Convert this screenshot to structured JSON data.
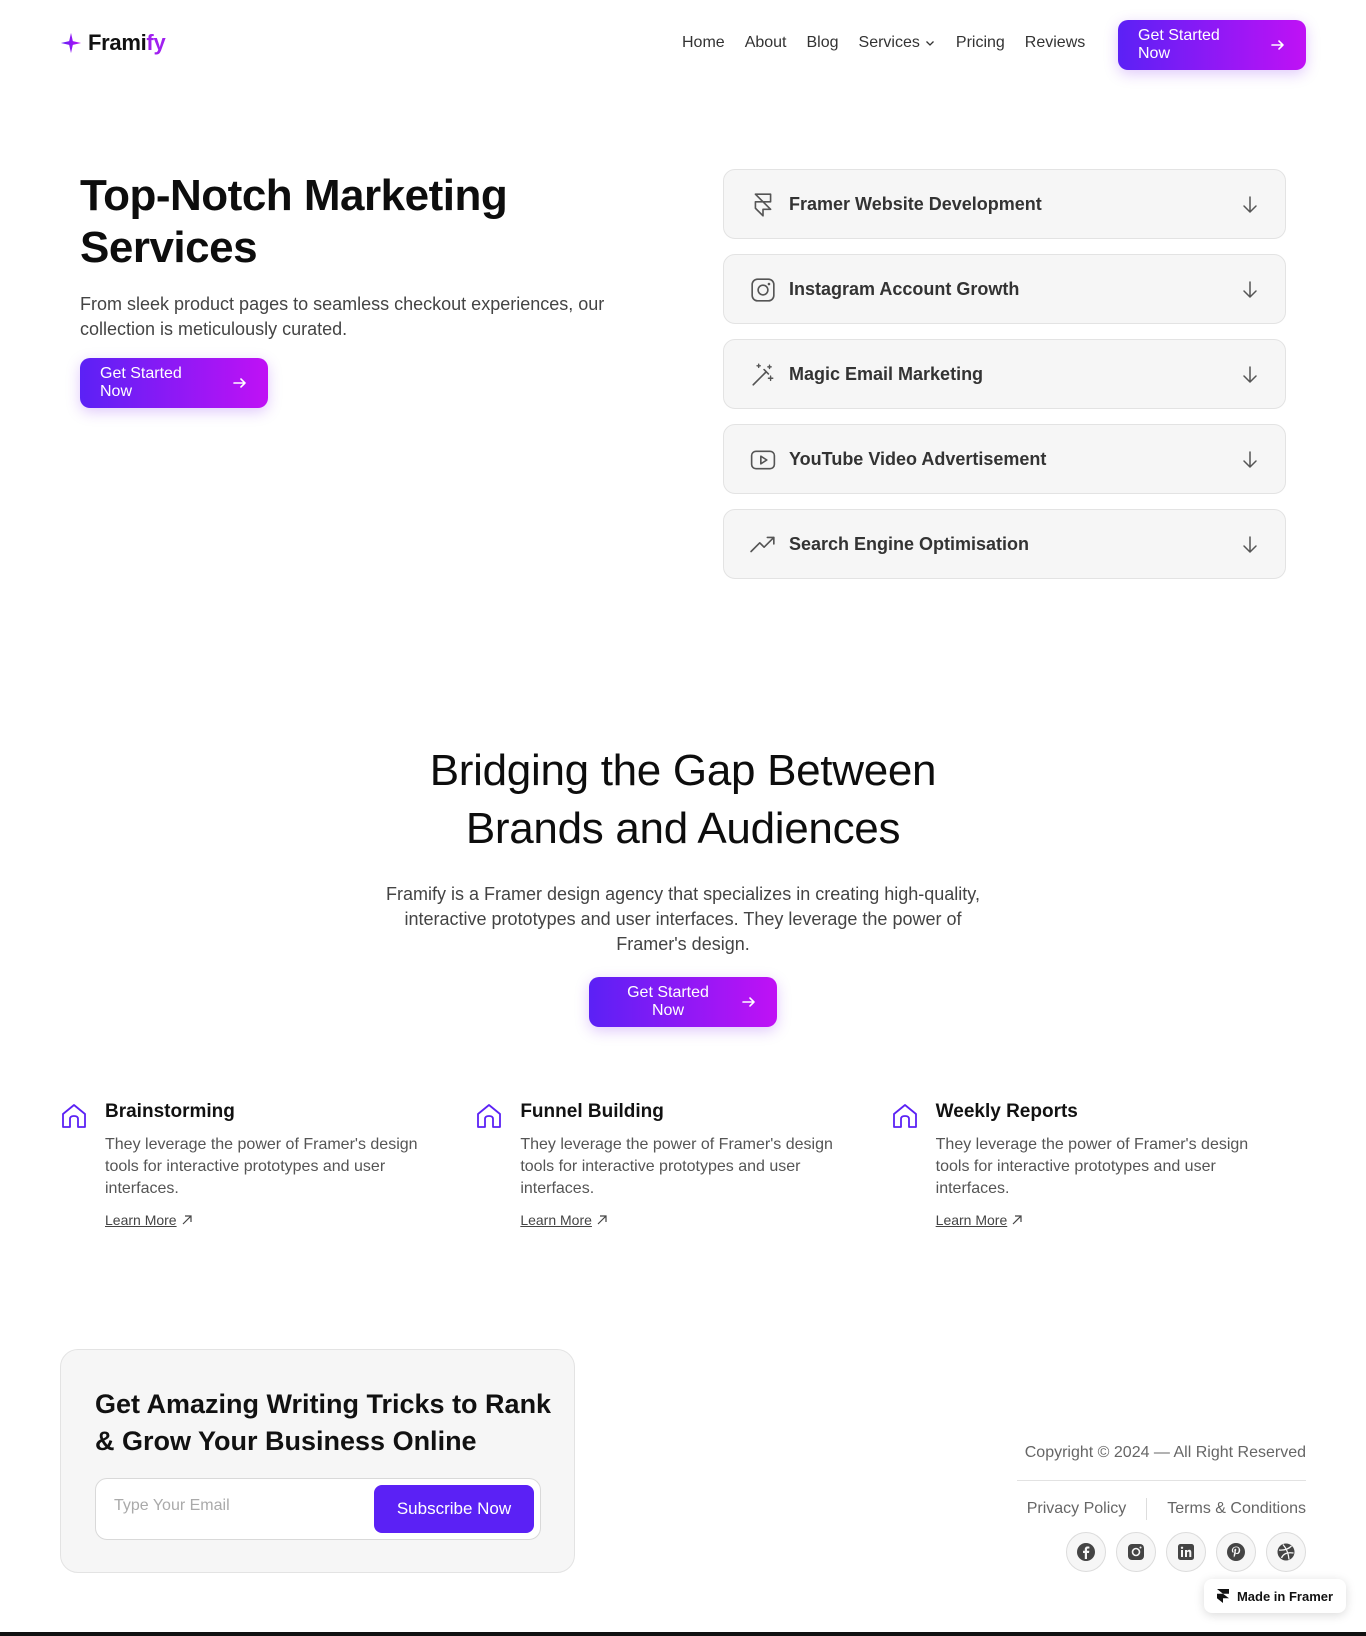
{
  "nav": {
    "logo_prefix": "Frami",
    "logo_accent": "fy",
    "links": [
      "Home",
      "About",
      "Blog",
      "Services",
      "Pricing",
      "Reviews"
    ],
    "cta": "Get Started Now"
  },
  "hero": {
    "title": "Top-Notch Marketing Services",
    "subtitle": "From sleek product pages to seamless checkout experiences, our collection is meticulously curated.",
    "cta": "Get Started Now"
  },
  "services": [
    {
      "label": "Framer Website Development",
      "icon": "framer-icon"
    },
    {
      "label": "Instagram Account Growth",
      "icon": "instagram-icon"
    },
    {
      "label": "Magic Email Marketing",
      "icon": "magic-wand-icon"
    },
    {
      "label": "YouTube Video Advertisement",
      "icon": "youtube-icon"
    },
    {
      "label": "Search Engine Optimisation",
      "icon": "trending-up-icon"
    }
  ],
  "about": {
    "title_line1": "Bridging the Gap Between",
    "title_line2": "Brands and Audiences",
    "subtitle": "Framify is a Framer design agency that specializes in creating high-quality, interactive prototypes and user interfaces. They leverage the power of Framer's design.",
    "cta": "Get Started Now"
  },
  "features": [
    {
      "title": "Brainstorming",
      "desc": "They leverage the power of Framer's design tools for interactive prototypes and user interfaces.",
      "link": "Learn More"
    },
    {
      "title": "Funnel Building",
      "desc": "They leverage the power of Framer's design tools for interactive prototypes and user interfaces.",
      "link": "Learn More"
    },
    {
      "title": "Weekly Reports",
      "desc": "They leverage the power of Framer's design tools for interactive prototypes and user interfaces.",
      "link": "Learn More"
    }
  ],
  "newsletter": {
    "title": "Get Amazing Writing Tricks to Rank & Grow Your Business Online",
    "placeholder": "Type Your Email",
    "button": "Subscribe Now"
  },
  "footer": {
    "copyright": "Copyright © 2024 — All Right Reserved",
    "privacy": "Privacy Policy",
    "terms": "Terms & Conditions",
    "socials": [
      "facebook-icon",
      "instagram-icon",
      "linkedin-icon",
      "pinterest-icon",
      "dribbble-icon"
    ]
  },
  "badge": "Made in Framer",
  "colors": {
    "accent_start": "#5b21f5",
    "accent_end": "#c011f5",
    "feature_icon": "#5b21f5"
  }
}
